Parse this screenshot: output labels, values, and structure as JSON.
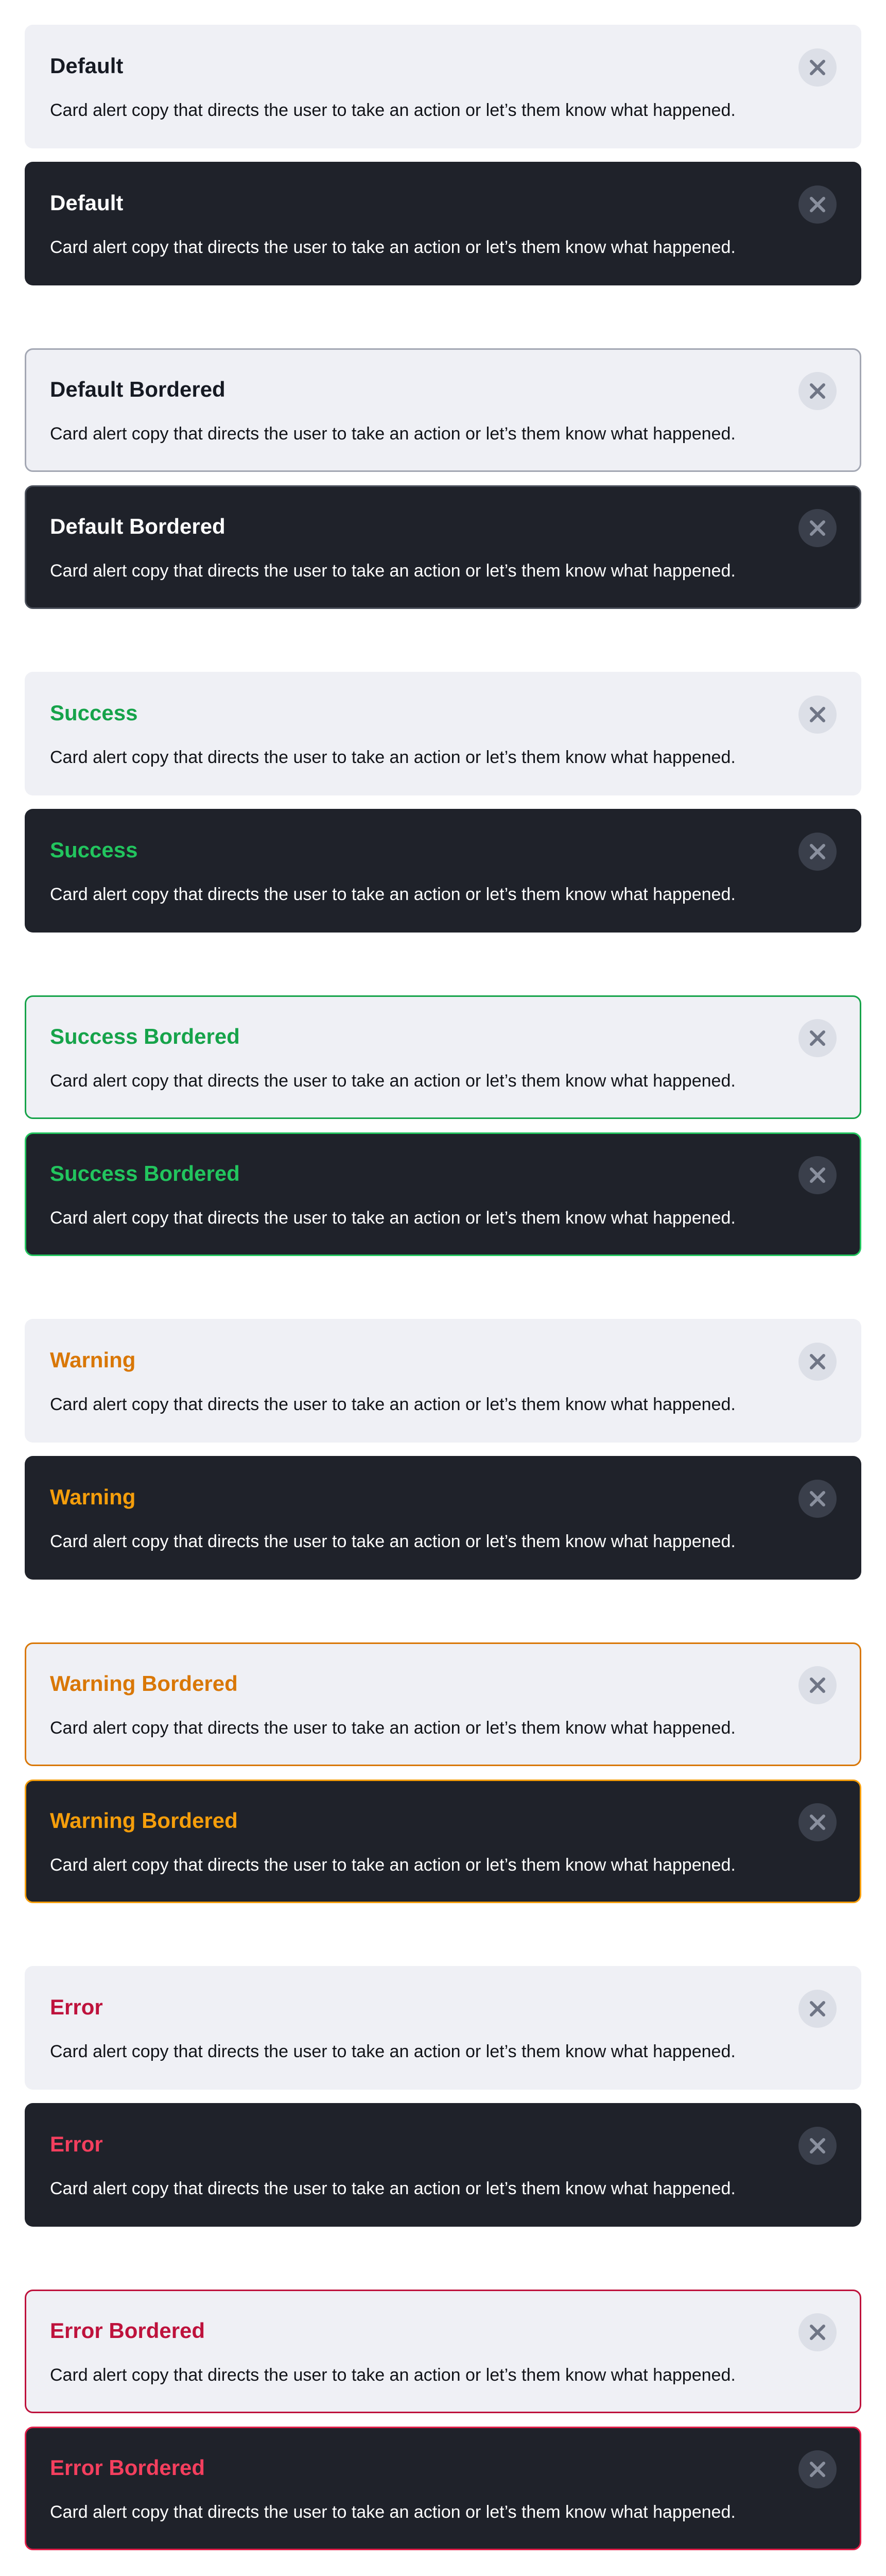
{
  "colors": {
    "light_bg": "#eff0f5",
    "dark_bg": "#1f222a",
    "success": "#16a34a",
    "warning": "#d97706",
    "error": "#be123c"
  },
  "close_icon": "close-icon",
  "alerts": [
    {
      "title": "Default",
      "body": "Card alert copy that directs the user to take an action or let’s them know what happened."
    },
    {
      "title": "Default",
      "body": "Card alert copy that directs the user to take an action or let’s them know what happened."
    },
    {
      "title": "Default Bordered",
      "body": "Card alert copy that directs the user to take an action or let’s them know what happened."
    },
    {
      "title": "Default Bordered",
      "body": "Card alert copy that directs the user to take an action or let’s them know what happened."
    },
    {
      "title": "Success",
      "body": "Card alert copy that directs the user to take an action or let’s them know what happened."
    },
    {
      "title": "Success",
      "body": "Card alert copy that directs the user to take an action or let’s them know what happened."
    },
    {
      "title": "Success Bordered",
      "body": "Card alert copy that directs the user to take an action or let’s them know what happened."
    },
    {
      "title": "Success Bordered",
      "body": "Card alert copy that directs the user to take an action or let’s them know what happened."
    },
    {
      "title": "Warning",
      "body": "Card alert copy that directs the user to take an action or let’s them know what happened."
    },
    {
      "title": "Warning",
      "body": "Card alert copy that directs the user to take an action or let’s them know what happened."
    },
    {
      "title": "Warning Bordered",
      "body": "Card alert copy that directs the user to take an action or let’s them know what happened."
    },
    {
      "title": "Warning Bordered",
      "body": "Card alert copy that directs the user to take an action or let’s them know what happened."
    },
    {
      "title": "Error",
      "body": "Card alert copy that directs the user to take an action or let’s them know what happened."
    },
    {
      "title": "Error",
      "body": "Card alert copy that directs the user to take an action or let’s them know what happened."
    },
    {
      "title": "Error Bordered",
      "body": "Card alert copy that directs the user to take an action or let’s them know what happened."
    },
    {
      "title": "Error Bordered",
      "body": "Card alert copy that directs the user to take an action or let’s them know what happened."
    }
  ]
}
